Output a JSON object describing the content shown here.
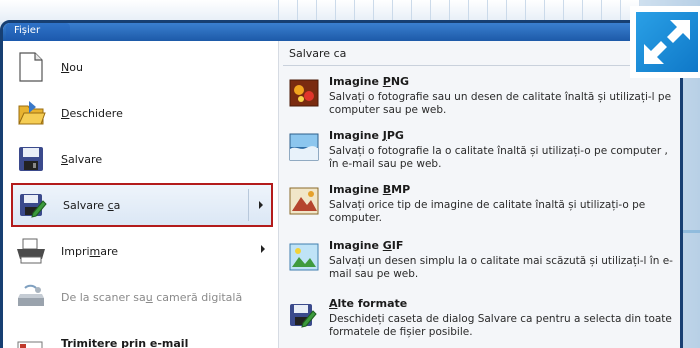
{
  "menu": {
    "tab_label": "Fișier",
    "left_items": [
      {
        "label_pre": "",
        "label_u": "N",
        "label_post": "ou",
        "icon": "new-document-icon"
      },
      {
        "label_pre": "",
        "label_u": "D",
        "label_post": "eschidere",
        "icon": "open-folder-icon"
      },
      {
        "label_pre": "",
        "label_u": "S",
        "label_post": "alvare",
        "icon": "save-floppy-icon"
      },
      {
        "label_pre": "Salvare ",
        "label_u": "c",
        "label_post": "a",
        "icon": "save-as-icon"
      },
      {
        "label_pre": "Impri",
        "label_u": "m",
        "label_post": "are",
        "icon": "printer-icon"
      },
      {
        "label_pre": "De la scaner sa",
        "label_u": "u",
        "label_post": " cameră digitală",
        "icon": "scanner-icon"
      },
      {
        "label_pre": "Trimitere prin e-mail",
        "label_u": "",
        "label_post": "",
        "icon": "email-icon"
      }
    ],
    "right_header": "Salvare ca",
    "right_items": [
      {
        "title_pre": "Imagine ",
        "title_u": "P",
        "title_post": "NG",
        "desc": "Salvați o fotografie sau un desen de calitate înaltă și utilizați-l pe computer sau pe web.",
        "icon": "png-image-icon"
      },
      {
        "title_pre": "Imagine ",
        "title_u": "J",
        "title_post": "PG",
        "desc": "Salvați o fotografie la o calitate înaltă și utilizați-o pe computer , în e-mail sau pe web.",
        "icon": "jpg-image-icon"
      },
      {
        "title_pre": "Imagine ",
        "title_u": "B",
        "title_post": "MP",
        "desc": "Salvați orice tip de imagine de calitate înaltă și utilizați-o pe computer.",
        "icon": "bmp-image-icon"
      },
      {
        "title_pre": "Imagine ",
        "title_u": "G",
        "title_post": "IF",
        "desc": "Salvați un desen simplu la o calitate mai scăzută și utilizați-l în e-mail sau pe web.",
        "icon": "gif-image-icon"
      },
      {
        "title_pre": "",
        "title_u": "A",
        "title_post": "lte formate",
        "desc": "Deschideți caseta de dialog Salvare ca pentru a selecta din toate formatele de fișier posibile.",
        "icon": "other-formats-icon"
      }
    ]
  },
  "colors": {
    "titlebar": "#1d5aa8",
    "selection_border": "#b31b1b",
    "expand_badge": "#1a86d0"
  }
}
